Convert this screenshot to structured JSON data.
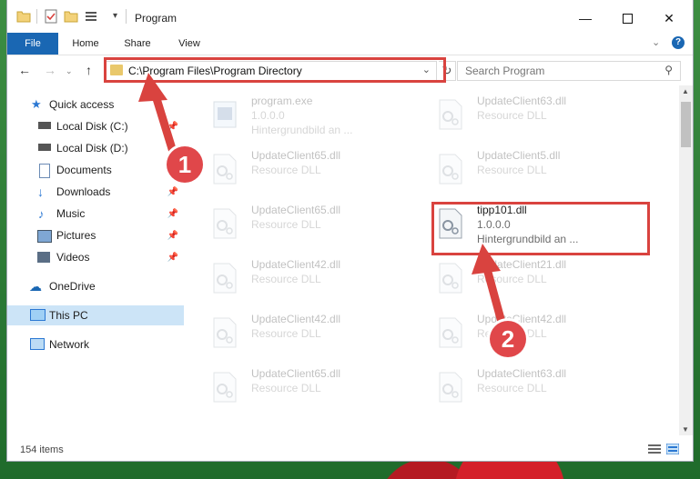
{
  "window": {
    "title": "Program",
    "quick_access_menu_glyph": "▾"
  },
  "ribbon": {
    "tabs": [
      "File",
      "Home",
      "Share",
      "View"
    ]
  },
  "nav": {
    "address": "C:\\Program Files\\Program Directory",
    "search_placeholder": "Search Program"
  },
  "sidebar": {
    "items": [
      {
        "label": "Quick access",
        "icon": "star-icon"
      },
      {
        "label": "Local Disk (C:)",
        "icon": "drive-icon"
      },
      {
        "label": "Local Disk (D:)",
        "icon": "drive-icon"
      },
      {
        "label": "Documents",
        "icon": "documents-icon"
      },
      {
        "label": "Downloads",
        "icon": "download-icon"
      },
      {
        "label": "Music",
        "icon": "music-icon"
      },
      {
        "label": "Pictures",
        "icon": "pictures-icon"
      },
      {
        "label": "Videos",
        "icon": "videos-icon"
      },
      {
        "label": "OneDrive",
        "icon": "cloud-icon"
      },
      {
        "label": "This PC",
        "icon": "computer-icon"
      },
      {
        "label": "Network",
        "icon": "network-icon"
      }
    ]
  },
  "files": [
    {
      "name": "program.exe",
      "desc": "1.0.0.0",
      "extra": "Hintergrundbild an ...",
      "kind": "exe"
    },
    {
      "name": "UpdateClient63.dll",
      "desc": "Resource DLL",
      "extra": "",
      "kind": "dll"
    },
    {
      "name": "UpdateClient65.dll",
      "desc": "Resource DLL",
      "extra": "",
      "kind": "dll"
    },
    {
      "name": "UpdateClient5.dll",
      "desc": "Resource DLL",
      "extra": "",
      "kind": "dll"
    },
    {
      "name": "UpdateClient65.dll",
      "desc": "Resource DLL",
      "extra": "",
      "kind": "dll"
    },
    {
      "name": "tipp101.dll",
      "desc": "1.0.0.0",
      "extra": "Hintergrundbild an ...",
      "kind": "dll"
    },
    {
      "name": "UpdateClient42.dll",
      "desc": "Resource DLL",
      "extra": "",
      "kind": "dll"
    },
    {
      "name": "UpdateClient21.dll",
      "desc": "Resource DLL",
      "extra": "",
      "kind": "dll"
    },
    {
      "name": "UpdateClient42.dll",
      "desc": "Resource DLL",
      "extra": "",
      "kind": "dll"
    },
    {
      "name": "UpdateClient42.dll",
      "desc": "Resource DLL",
      "extra": "",
      "kind": "dll"
    },
    {
      "name": "UpdateClient65.dll",
      "desc": "Resource DLL",
      "extra": "",
      "kind": "dll"
    },
    {
      "name": "UpdateClient63.dll",
      "desc": "Resource DLL",
      "extra": "",
      "kind": "dll"
    }
  ],
  "status": {
    "count": "154 items"
  },
  "annotations": {
    "badge1": "1",
    "badge2": "2",
    "highlight_color": "#d9433f",
    "badge_color": "#e0474a"
  },
  "colors": {
    "accent": "#1a67b3",
    "selection": "#cce4f7"
  }
}
